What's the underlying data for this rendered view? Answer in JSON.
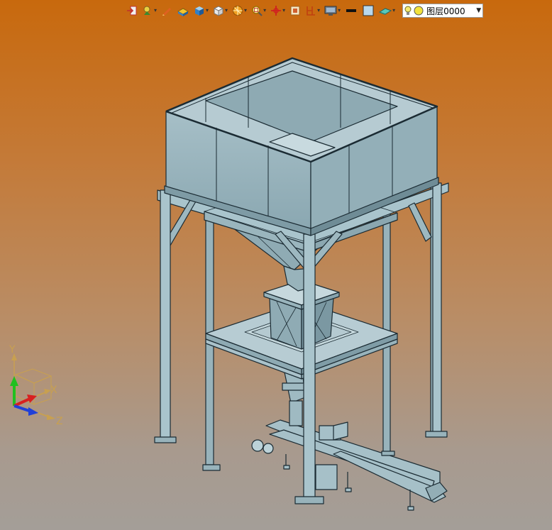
{
  "toolbar": {
    "buttons": [
      {
        "name": "import-icon",
        "dropdown": false
      },
      {
        "name": "snap-icon",
        "dropdown": true
      },
      {
        "name": "sketch-pen-icon",
        "dropdown": false
      },
      {
        "name": "box-select-icon",
        "dropdown": false
      },
      {
        "name": "solid-view-icon",
        "dropdown": true
      },
      {
        "name": "wireframe-cube-icon",
        "dropdown": true
      },
      {
        "name": "render-mode-icon",
        "dropdown": true
      },
      {
        "name": "zoom-icon",
        "dropdown": true
      },
      {
        "name": "origin-icon",
        "dropdown": true
      },
      {
        "name": "grid-icon",
        "dropdown": false
      },
      {
        "name": "section-icon",
        "dropdown": true
      },
      {
        "name": "display-icon",
        "dropdown": true
      },
      {
        "name": "line-color-icon",
        "dropdown": false
      },
      {
        "name": "fill-color-icon",
        "dropdown": false
      },
      {
        "name": "plane-icon",
        "dropdown": true
      }
    ],
    "layer": {
      "name": "图层0000",
      "colors": {
        "bulb": "#f4e870",
        "circle": "#f2e23c"
      }
    }
  },
  "triad": {
    "x_label": "X",
    "y_label": "Y",
    "z_label": "Z",
    "colors": {
      "x": "#d82020",
      "y": "#20c020",
      "z": "#2040d8"
    }
  },
  "colors": {
    "steel": "#a9c4cc",
    "steel_dark": "#5f7c86",
    "panel": "#9cb6be",
    "outline": "#1b2b33"
  }
}
